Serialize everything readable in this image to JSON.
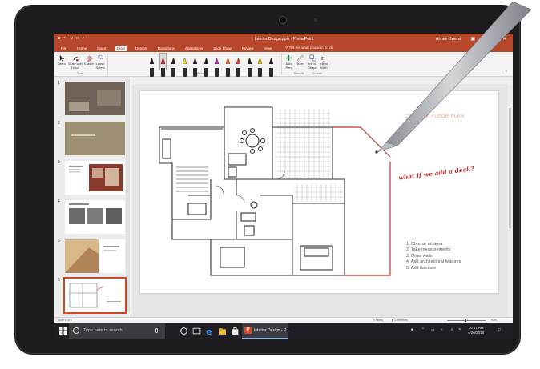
{
  "window": {
    "doc_title": "Interior Design.pptx  -  PowerPoint",
    "user": "Aimee Owens"
  },
  "tabs": [
    {
      "label": "File"
    },
    {
      "label": "Home"
    },
    {
      "label": "Insert"
    },
    {
      "label": "Draw",
      "active": true
    },
    {
      "label": "Design"
    },
    {
      "label": "Transitions"
    },
    {
      "label": "Animations"
    },
    {
      "label": "Slide Show"
    },
    {
      "label": "Review"
    },
    {
      "label": "View"
    }
  ],
  "tell_me": "Tell me what you want to do",
  "ribbon": {
    "tools": {
      "select": "Select",
      "draw_with_touch": "Draw with Touch",
      "eraser": "Eraser",
      "lasso_select": "Lasso Select",
      "group_label": "Tools"
    },
    "pens": {
      "colors": [
        "#1a1a1a",
        "#c0322b",
        "#1a1a1a",
        "#f2e229",
        "#1a1a1a",
        "#1a1a1a",
        "#b23fb0",
        "#e36c1f",
        "#e84c3d",
        "#1a1a1a",
        "#f0c419",
        "#1a1a1a"
      ],
      "group_label": "Pens"
    },
    "add_pen": "Add Pen",
    "ruler": "Ruler",
    "stencils_label": "Stencils",
    "ink_to_shape": "Ink to Shape",
    "ink_to_math": "Ink to Math",
    "convert_label": "Convert"
  },
  "thumbnails": [
    {
      "num": "1",
      "bg": "#6e6258"
    },
    {
      "num": "2",
      "bg": "#9c8f72"
    },
    {
      "num": "3",
      "bg": "#ffffff"
    },
    {
      "num": "4",
      "bg": "#ffffff"
    },
    {
      "num": "5",
      "bg": "#d8b889"
    },
    {
      "num": "6",
      "bg": "#ffffff",
      "selected": true
    }
  ],
  "slide": {
    "title": "CREATE A FLOOR PLAN",
    "handwritten_note": "what if we add a deck?",
    "steps": [
      "1. Choose an area",
      "2. Take measurements",
      "3. Draw walls",
      "4. Add architectural features",
      "5. Add furniture"
    ]
  },
  "status": {
    "slide_info": "Slide 6 of 6",
    "notes": "Notes",
    "comments": "Comments",
    "zoom": "93%"
  },
  "taskbar": {
    "search_placeholder": "Type here to search",
    "app_label": "Interior Design - P...",
    "time": "10:17 AM",
    "date": "4/20/2018"
  },
  "colors": {
    "accent": "#b7472a",
    "ink_red": "#c0322b"
  }
}
